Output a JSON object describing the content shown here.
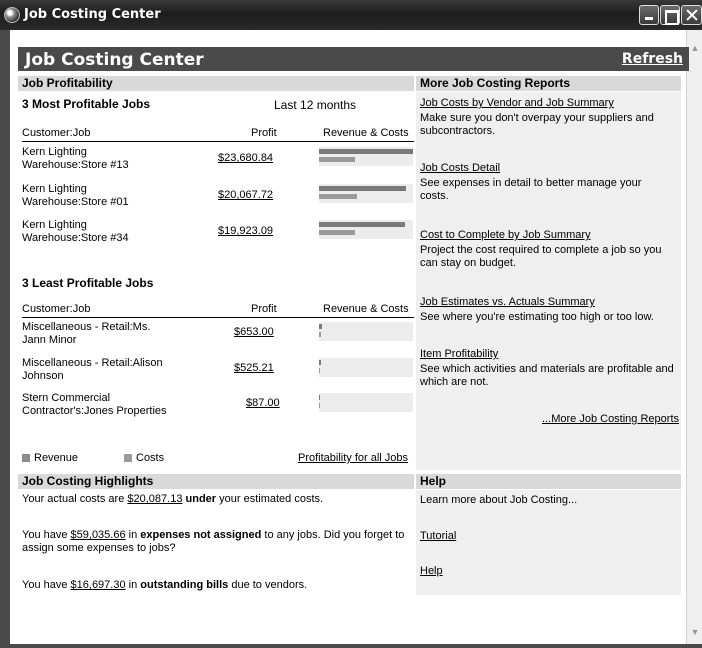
{
  "window": {
    "title": "Job Costing Center"
  },
  "header": {
    "title": "Job Costing Center",
    "refresh": "Refresh"
  },
  "profitability": {
    "section_title": "Job Profitability",
    "most_title": "3 Most Profitable Jobs",
    "period": "Last 12 months",
    "col_customer": "Customer:Job",
    "col_profit": "Profit",
    "col_revcost": "Revenue & Costs",
    "most_jobs": [
      {
        "line1": "Kern Lighting",
        "line2": "Warehouse:Store #13",
        "profit": "$23,680.84",
        "revenue_frac": 1.0,
        "cost_frac": 0.38
      },
      {
        "line1": "Kern Lighting",
        "line2": "Warehouse:Store #01",
        "profit": "$20,067.72",
        "revenue_frac": 0.93,
        "cost_frac": 0.4
      },
      {
        "line1": "Kern Lighting",
        "line2": "Warehouse:Store #34",
        "profit": "$19,923.09",
        "revenue_frac": 0.92,
        "cost_frac": 0.38
      }
    ],
    "least_title": "3 Least Profitable Jobs",
    "least_jobs": [
      {
        "line1": "Miscellaneous - Retail:Ms.",
        "line2": "Jann Minor",
        "profit": "$653.00",
        "revenue_frac": 0.03,
        "cost_frac": 0.02
      },
      {
        "line1": "Miscellaneous - Retail:Alison",
        "line2": "Johnson",
        "profit": "$525.21",
        "revenue_frac": 0.02,
        "cost_frac": 0.01
      },
      {
        "line1": "Stern Commercial",
        "line2": "Contractor's:Jones Properties",
        "profit": "$87.00",
        "revenue_frac": 0.01,
        "cost_frac": 0.01
      }
    ],
    "legend_revenue": "Revenue",
    "legend_costs": "Costs",
    "all_jobs_link": "Profitability for all Jobs",
    "revenue_color": "#7a7a7a",
    "cost_color": "#9a9a9a"
  },
  "more_reports": {
    "section_title": "More Job Costing Reports",
    "items": [
      {
        "link": "Job Costs by Vendor and Job Summary",
        "desc": "Make sure you don't overpay your suppliers and subcontractors."
      },
      {
        "link": "Job Costs Detail",
        "desc": "See expenses in detail to better manage your costs."
      },
      {
        "link": "Cost to Complete by Job Summary",
        "desc": "Project the cost required to complete a job so you can stay on budget."
      },
      {
        "link": "Job Estimates vs. Actuals Summary",
        "desc": "See where you're estimating too high or too low."
      },
      {
        "link": "Item Profitability",
        "desc": "See which activities and materials are profitable and which are not."
      }
    ],
    "more_link": "...More Job Costing Reports"
  },
  "highlights": {
    "section_title": "Job Costing Highlights",
    "line1": {
      "pre": "Your actual costs are ",
      "amount": "$20,087.13",
      "bold": " under",
      "post": " your estimated costs."
    },
    "line2": {
      "pre": "You have ",
      "amount": "$59,035.66",
      "mid": " in ",
      "bold": "expenses not assigned",
      "post": " to any jobs. Did you forget to assign some expenses to jobs?"
    },
    "line3": {
      "pre": "You have ",
      "amount": "$16,697.30",
      "mid": " in ",
      "bold": "outstanding bills",
      "post": " due to vendors."
    }
  },
  "help": {
    "section_title": "Help",
    "intro": "Learn more about Job Costing...",
    "tutorial": "Tutorial",
    "help_link": "Help"
  }
}
